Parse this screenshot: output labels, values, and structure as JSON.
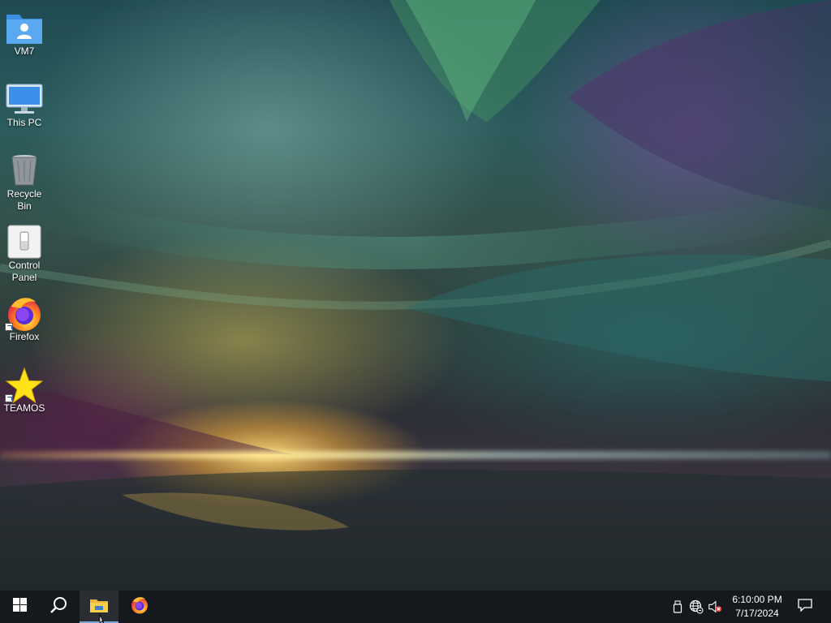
{
  "desktop": {
    "icons": [
      {
        "label": "VM7",
        "icon": "user-folder-icon"
      },
      {
        "label": "This PC",
        "icon": "computer-icon"
      },
      {
        "label": "Recycle Bin",
        "icon": "recycle-bin-icon"
      },
      {
        "label": "Control Panel",
        "icon": "control-panel-icon"
      },
      {
        "label": "Firefox",
        "icon": "firefox-icon",
        "shortcut": true
      },
      {
        "label": "TEAMOS",
        "icon": "star-icon",
        "shortcut": true
      }
    ]
  },
  "taskbar": {
    "start_icon": "windows-start-icon",
    "search_icon": "search-icon",
    "pinned": [
      {
        "name": "File Explorer",
        "icon": "file-explorer-icon",
        "active": true
      },
      {
        "name": "Firefox",
        "icon": "firefox-icon",
        "active": false
      }
    ],
    "tray": {
      "icons": [
        "usb-device-icon",
        "network-globe-icon",
        "volume-muted-icon"
      ],
      "time": "6:10:00 PM",
      "date": "7/17/2024",
      "notification_icon": "action-center-icon"
    }
  },
  "colors": {
    "taskbar_bg": "#15181c",
    "active_indicator": "#7aa6d6"
  }
}
